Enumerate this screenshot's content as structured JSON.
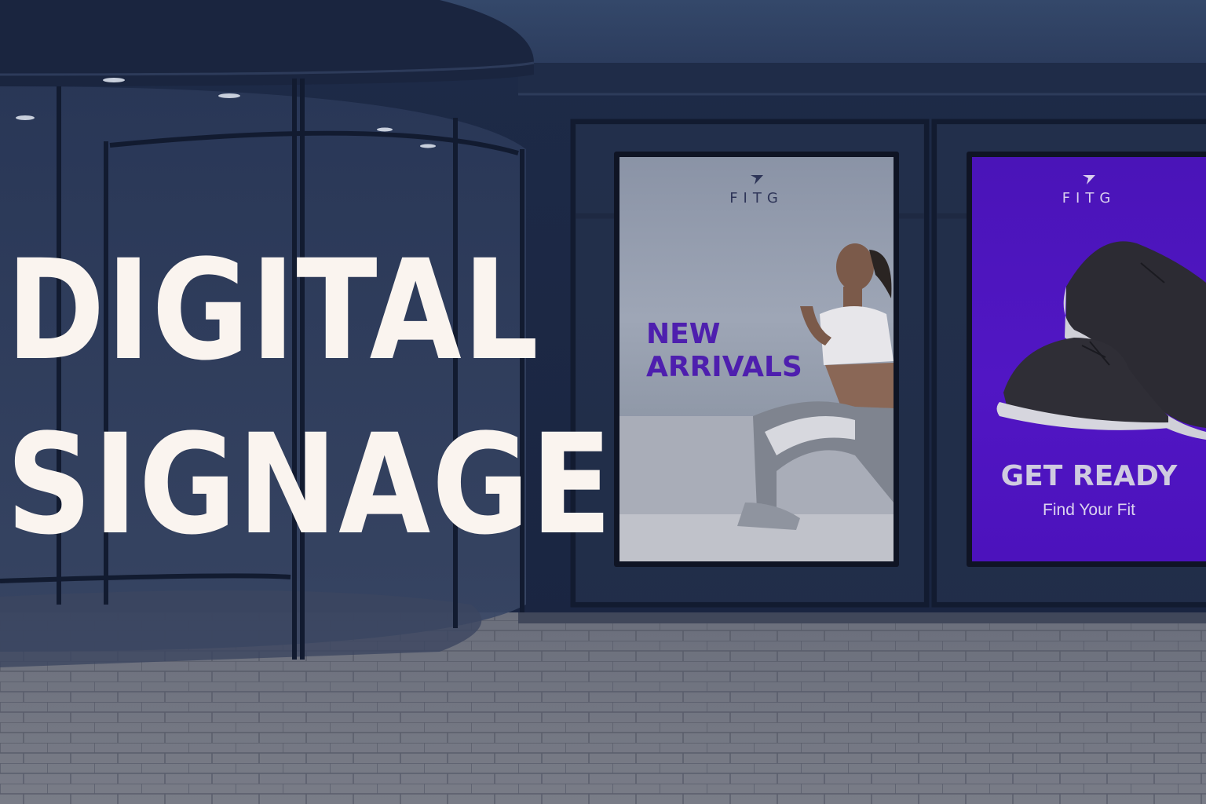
{
  "headline": {
    "line1": "DIGITAL",
    "line2": "SIGNAGE"
  },
  "screens": [
    {
      "brand": "FITG",
      "tagline_line1": "NEW",
      "tagline_line2": "ARRIVALS",
      "accent": "#4e1fae"
    },
    {
      "brand": "FITG",
      "headline": "GET READY",
      "subline": "Find Your Fit",
      "background": "#5116c4"
    }
  ]
}
